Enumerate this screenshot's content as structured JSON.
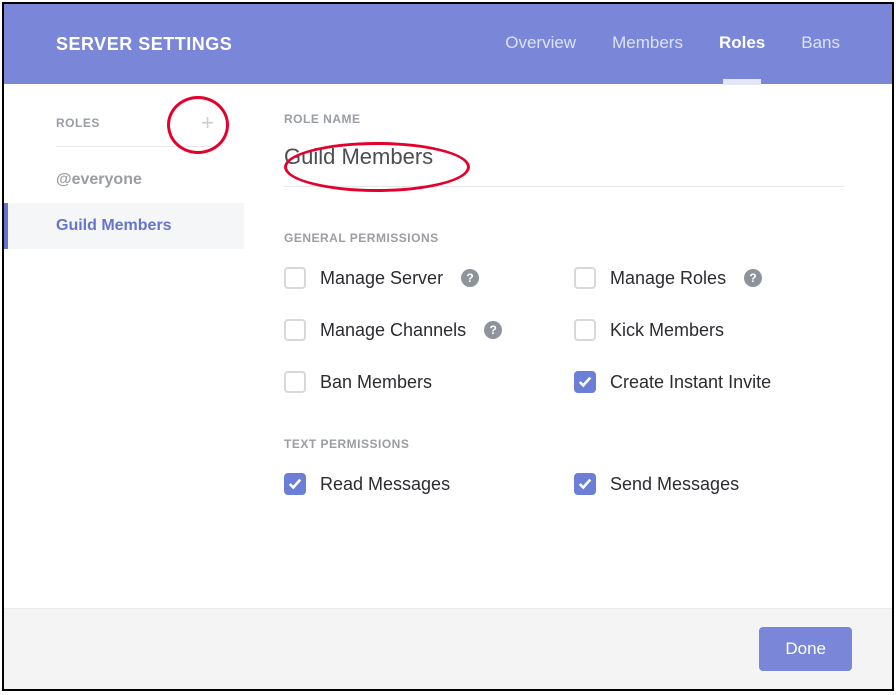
{
  "header": {
    "title": "SERVER SETTINGS",
    "tabs": [
      {
        "label": "Overview",
        "active": false
      },
      {
        "label": "Members",
        "active": false
      },
      {
        "label": "Roles",
        "active": true
      },
      {
        "label": "Bans",
        "active": false
      }
    ]
  },
  "sidebar": {
    "heading": "ROLES",
    "items": [
      {
        "label": "@everyone",
        "selected": false
      },
      {
        "label": "Guild Members",
        "selected": true
      }
    ]
  },
  "main": {
    "role_name_label": "ROLE NAME",
    "role_name_value": "Guild Members",
    "sections": [
      {
        "label": "GENERAL PERMISSIONS",
        "perms": [
          {
            "label": "Manage Server",
            "checked": false,
            "help": true
          },
          {
            "label": "Manage Roles",
            "checked": false,
            "help": true
          },
          {
            "label": "Manage Channels",
            "checked": false,
            "help": true
          },
          {
            "label": "Kick Members",
            "checked": false,
            "help": false
          },
          {
            "label": "Ban Members",
            "checked": false,
            "help": false
          },
          {
            "label": "Create Instant Invite",
            "checked": true,
            "help": false
          }
        ]
      },
      {
        "label": "TEXT PERMISSIONS",
        "perms": [
          {
            "label": "Read Messages",
            "checked": true,
            "help": false
          },
          {
            "label": "Send Messages",
            "checked": true,
            "help": false
          }
        ]
      }
    ]
  },
  "footer": {
    "done_label": "Done"
  }
}
